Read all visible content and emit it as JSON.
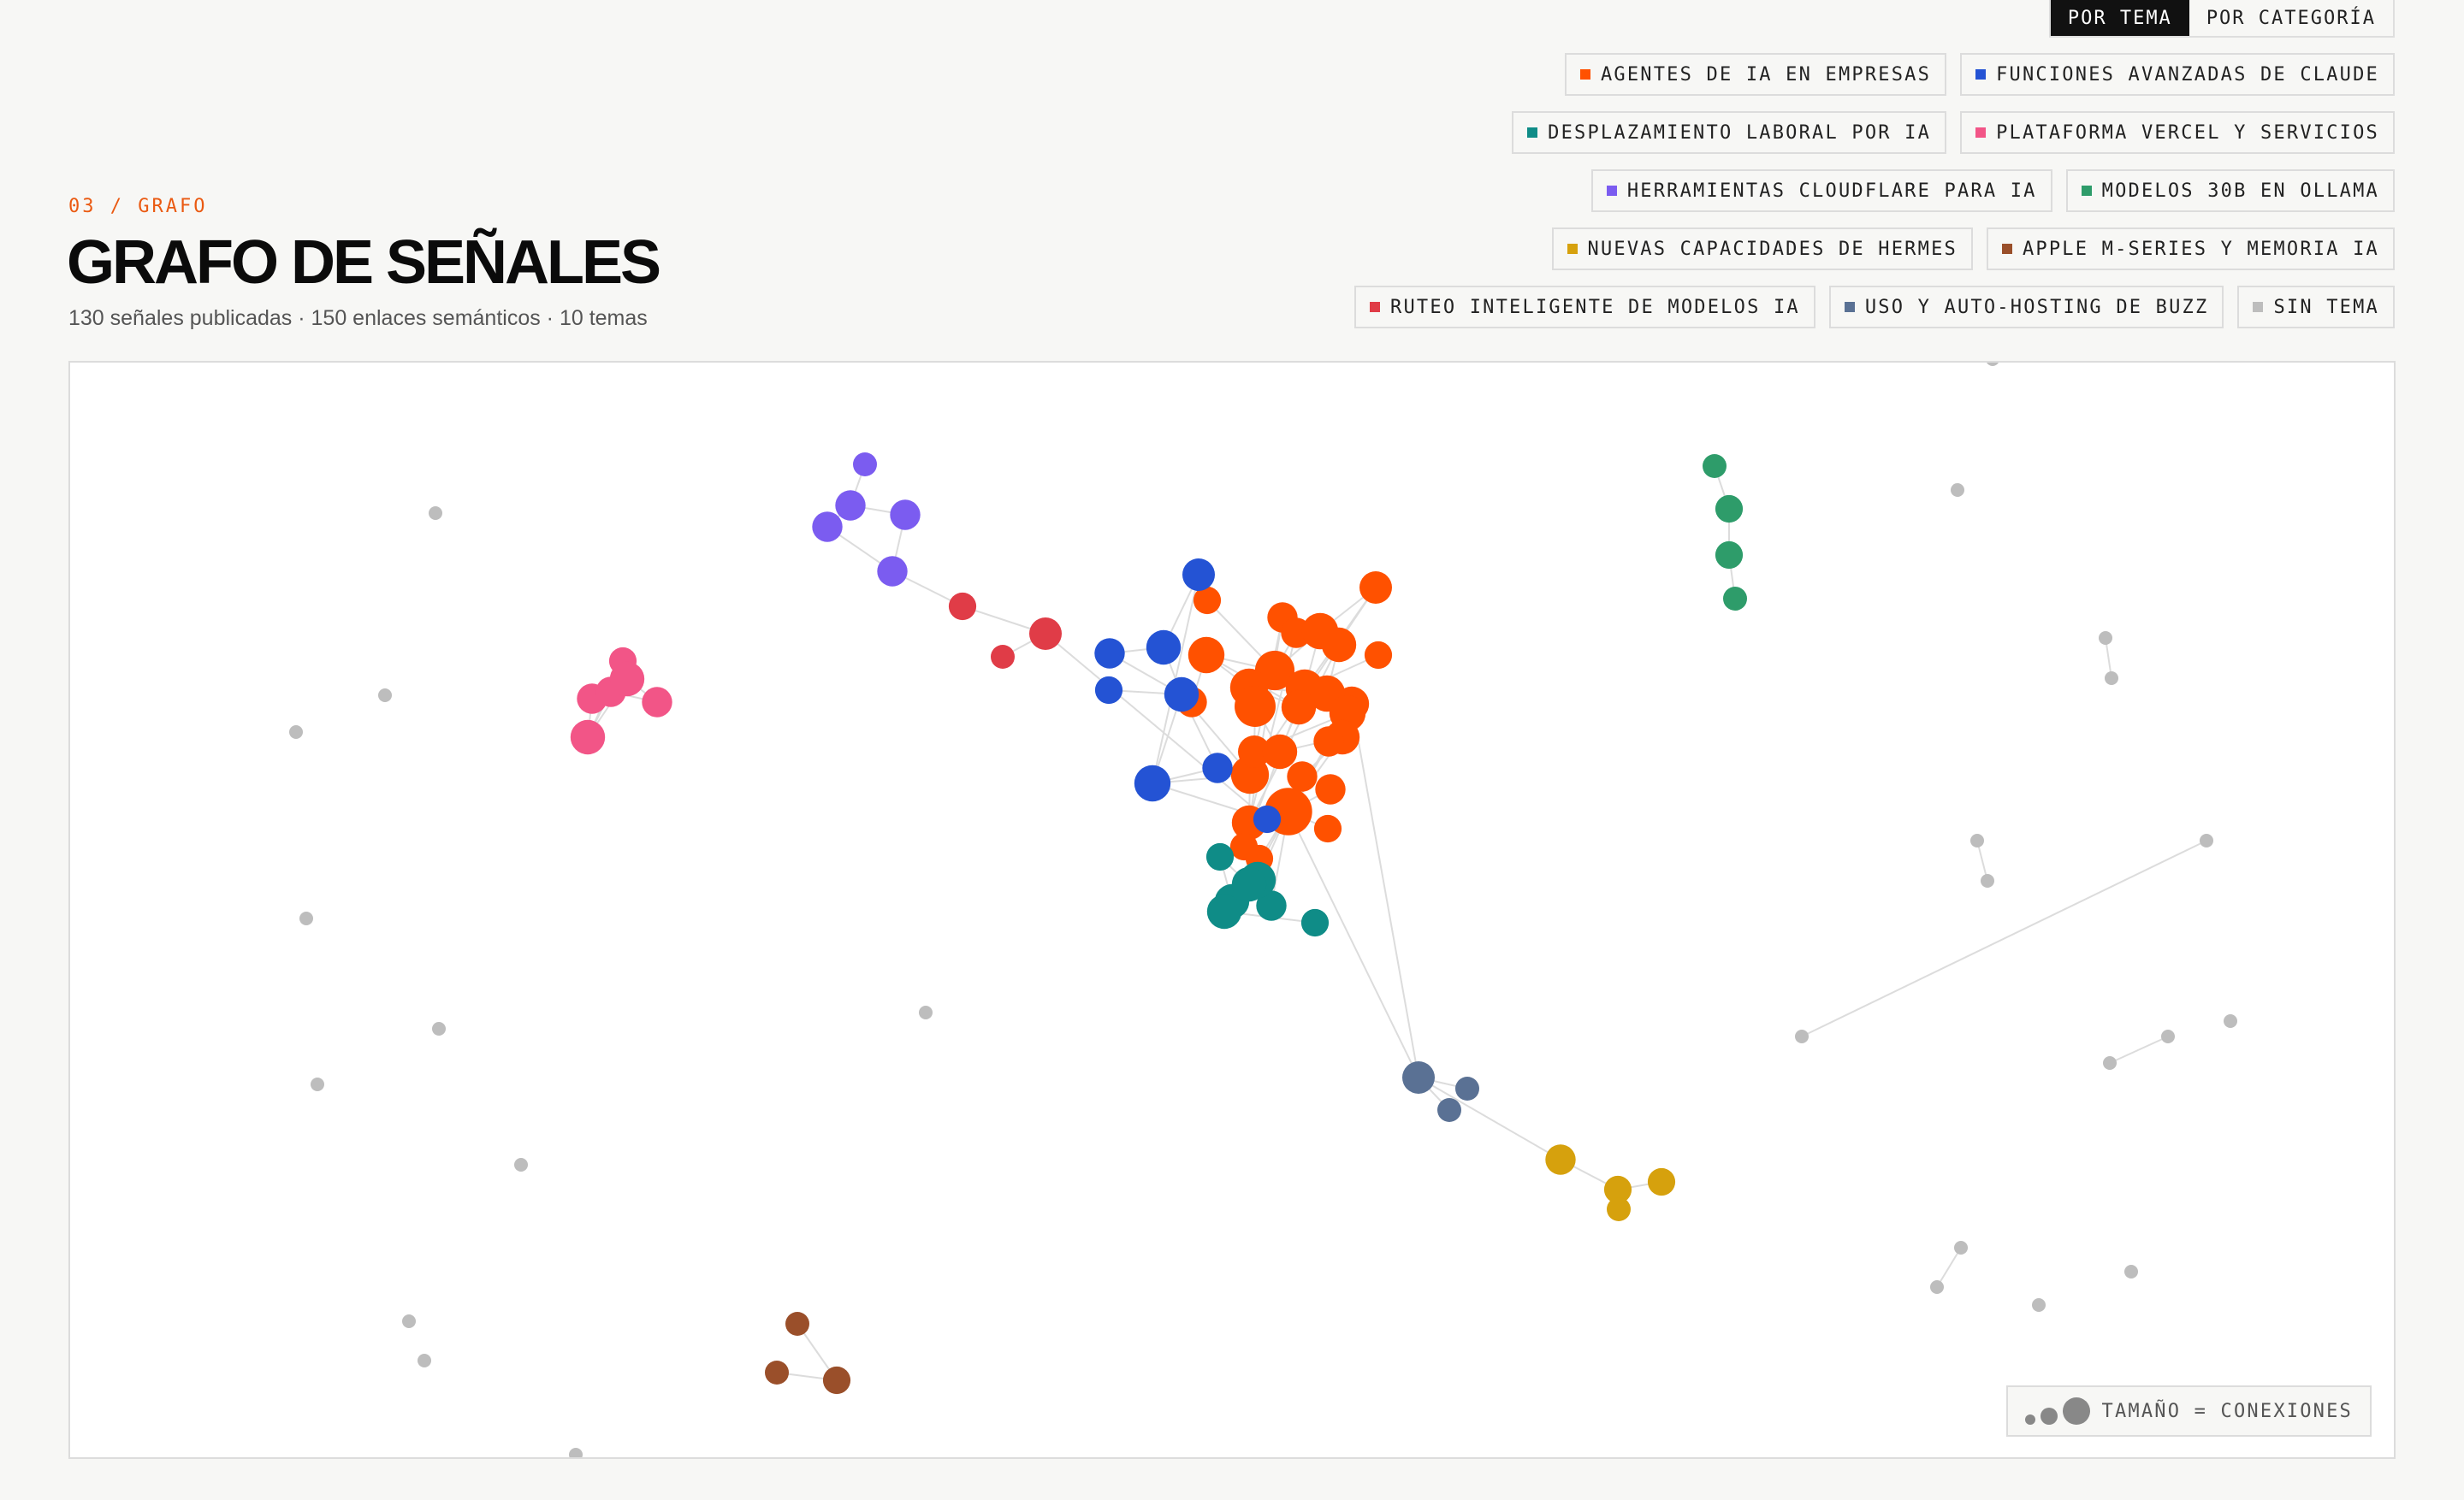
{
  "view_toggle": [
    {
      "label": "POR TEMA",
      "active": true
    },
    {
      "label": "POR CATEGORÍA",
      "active": false
    }
  ],
  "themes": [
    {
      "id": "agentes",
      "label": "AGENTES DE IA EN EMPRESAS",
      "color": "#ff5100"
    },
    {
      "id": "claude",
      "label": "FUNCIONES AVANZADAS DE CLAUDE",
      "color": "#2453d4"
    },
    {
      "id": "laboral",
      "label": "DESPLAZAMIENTO LABORAL POR IA",
      "color": "#0f8c87"
    },
    {
      "id": "vercel",
      "label": "PLATAFORMA VERCEL Y SERVICIOS",
      "color": "#f25587"
    },
    {
      "id": "cloudflare",
      "label": "HERRAMIENTAS CLOUDFLARE PARA IA",
      "color": "#7b5cf0"
    },
    {
      "id": "ollama",
      "label": "MODELOS 30B EN OLLAMA",
      "color": "#2e9c6a"
    },
    {
      "id": "hermes",
      "label": "NUEVAS CAPACIDADES DE HERMES",
      "color": "#d6a10d"
    },
    {
      "id": "apple",
      "label": "APPLE M-SERIES Y MEMORIA IA",
      "color": "#9a4f2a"
    },
    {
      "id": "ruteo",
      "label": "RUTEO INTELIGENTE DE MODELOS IA",
      "color": "#e03c47"
    },
    {
      "id": "buzz",
      "label": "USO Y AUTO-HOSTING DE BUZZ",
      "color": "#5a7194"
    },
    {
      "id": "none",
      "label": "SIN TEMA",
      "color": "#bdbdbd"
    }
  ],
  "header": {
    "kicker": "03 / GRAFO",
    "title": "GRAFO DE SEÑALES",
    "subtitle": "130 señales publicadas · 150 enlaces semánticos · 10 temas"
  },
  "size_legend": {
    "label": "TAMAÑO = CONEXIONES"
  },
  "graph": {
    "nodes": [
      {
        "id": "a1",
        "theme": "agentes",
        "deg": 7
      },
      {
        "id": "a2",
        "theme": "agentes",
        "deg": 2
      },
      {
        "id": "a3",
        "theme": "agentes",
        "deg": 3
      },
      {
        "id": "a4",
        "theme": "agentes",
        "deg": 5
      },
      {
        "id": "a5",
        "theme": "agentes",
        "deg": 4
      },
      {
        "id": "a6",
        "theme": "agentes",
        "deg": 3
      },
      {
        "id": "a7",
        "theme": "agentes",
        "deg": 6
      },
      {
        "id": "a8",
        "theme": "agentes",
        "deg": 5
      },
      {
        "id": "a9",
        "theme": "agentes",
        "deg": 8
      },
      {
        "id": "a10",
        "theme": "agentes",
        "deg": 7
      },
      {
        "id": "a11",
        "theme": "agentes",
        "deg": 6
      },
      {
        "id": "a12",
        "theme": "agentes",
        "deg": 2
      },
      {
        "id": "a13",
        "theme": "agentes",
        "deg": 6
      },
      {
        "id": "a14",
        "theme": "agentes",
        "deg": 3
      },
      {
        "id": "a15",
        "theme": "agentes",
        "deg": 7
      },
      {
        "id": "a16",
        "theme": "agentes",
        "deg": 9
      },
      {
        "id": "a17",
        "theme": "agentes",
        "deg": 5
      },
      {
        "id": "a18",
        "theme": "agentes",
        "deg": 5
      },
      {
        "id": "a19",
        "theme": "agentes",
        "deg": 4
      },
      {
        "id": "a20",
        "theme": "agentes",
        "deg": 5
      },
      {
        "id": "a21",
        "theme": "agentes",
        "deg": 6
      },
      {
        "id": "a22",
        "theme": "agentes",
        "deg": 5
      },
      {
        "id": "a23",
        "theme": "agentes",
        "deg": 3
      },
      {
        "id": "a24",
        "theme": "agentes",
        "deg": 14
      },
      {
        "id": "a25",
        "theme": "agentes",
        "deg": 3
      },
      {
        "id": "a26",
        "theme": "agentes",
        "deg": 3
      },
      {
        "id": "a27",
        "theme": "agentes",
        "deg": 2
      },
      {
        "id": "a28",
        "theme": "agentes",
        "deg": 2
      },
      {
        "id": "a29",
        "theme": "agentes",
        "deg": 2
      },
      {
        "id": "c1",
        "theme": "claude",
        "deg": 2
      },
      {
        "id": "c2",
        "theme": "claude",
        "deg": 5
      },
      {
        "id": "c3",
        "theme": "claude",
        "deg": 3
      },
      {
        "id": "c4",
        "theme": "claude",
        "deg": 4
      },
      {
        "id": "c5",
        "theme": "claude",
        "deg": 5
      },
      {
        "id": "c6",
        "theme": "claude",
        "deg": 6
      },
      {
        "id": "c7",
        "theme": "claude",
        "deg": 3
      },
      {
        "id": "c8",
        "theme": "claude",
        "deg": 2
      },
      {
        "id": "l1",
        "theme": "laboral",
        "deg": 3
      },
      {
        "id": "l2",
        "theme": "laboral",
        "deg": 2
      },
      {
        "id": "l3",
        "theme": "laboral",
        "deg": 6
      },
      {
        "id": "l4",
        "theme": "laboral",
        "deg": 5
      },
      {
        "id": "l5",
        "theme": "laboral",
        "deg": 5
      },
      {
        "id": "l6",
        "theme": "laboral",
        "deg": 5
      },
      {
        "id": "l7",
        "theme": "laboral",
        "deg": 2
      },
      {
        "id": "v1",
        "theme": "vercel",
        "deg": 3
      },
      {
        "id": "v2",
        "theme": "vercel",
        "deg": 5
      },
      {
        "id": "v3",
        "theme": "vercel",
        "deg": 3
      },
      {
        "id": "v4",
        "theme": "vercel",
        "deg": 2
      },
      {
        "id": "v5",
        "theme": "vercel",
        "deg": 5
      },
      {
        "id": "v6",
        "theme": "vercel",
        "deg": 3
      },
      {
        "id": "f1",
        "theme": "cloudflare",
        "deg": 1
      },
      {
        "id": "f2",
        "theme": "cloudflare",
        "deg": 3
      },
      {
        "id": "f3",
        "theme": "cloudflare",
        "deg": 3
      },
      {
        "id": "f4",
        "theme": "cloudflare",
        "deg": 3
      },
      {
        "id": "f5",
        "theme": "cloudflare",
        "deg": 3
      },
      {
        "id": "o1",
        "theme": "ollama",
        "deg": 1
      },
      {
        "id": "o2",
        "theme": "ollama",
        "deg": 2
      },
      {
        "id": "o3",
        "theme": "ollama",
        "deg": 2
      },
      {
        "id": "o4",
        "theme": "ollama",
        "deg": 1
      },
      {
        "id": "h1",
        "theme": "hermes",
        "deg": 3
      },
      {
        "id": "h2",
        "theme": "hermes",
        "deg": 2
      },
      {
        "id": "h3",
        "theme": "hermes",
        "deg": 2
      },
      {
        "id": "h4",
        "theme": "hermes",
        "deg": 1
      },
      {
        "id": "p1",
        "theme": "apple",
        "deg": 1
      },
      {
        "id": "p2",
        "theme": "apple",
        "deg": 1
      },
      {
        "id": "p3",
        "theme": "apple",
        "deg": 2
      },
      {
        "id": "r1",
        "theme": "ruteo",
        "deg": 2
      },
      {
        "id": "r2",
        "theme": "ruteo",
        "deg": 4
      },
      {
        "id": "r3",
        "theme": "ruteo",
        "deg": 1
      },
      {
        "id": "b1",
        "theme": "buzz",
        "deg": 4
      },
      {
        "id": "b2",
        "theme": "buzz",
        "deg": 1
      },
      {
        "id": "b3",
        "theme": "buzz",
        "deg": 1
      },
      {
        "id": "n1",
        "theme": "none",
        "deg": 1
      },
      {
        "id": "n2",
        "theme": "none",
        "deg": 1
      },
      {
        "id": "n3",
        "theme": "none",
        "deg": 1
      },
      {
        "id": "n4",
        "theme": "none",
        "deg": 1
      },
      {
        "id": "n5",
        "theme": "none",
        "deg": 1
      },
      {
        "id": "n6",
        "theme": "none",
        "deg": 1
      },
      {
        "id": "n7",
        "theme": "none",
        "deg": 1
      },
      {
        "id": "n8",
        "theme": "none",
        "deg": 1
      },
      {
        "id": "n9",
        "theme": "none",
        "deg": 1
      },
      {
        "id": "n10",
        "theme": "none",
        "deg": 1
      },
      {
        "id": "n11",
        "theme": "none",
        "deg": 1
      },
      {
        "id": "n12",
        "theme": "none",
        "deg": 1
      },
      {
        "id": "n13",
        "theme": "none",
        "deg": 1
      },
      {
        "id": "n14",
        "theme": "none",
        "deg": 1
      },
      {
        "id": "n15",
        "theme": "none",
        "deg": 1
      },
      {
        "id": "n16",
        "theme": "none",
        "deg": 1
      },
      {
        "id": "n17",
        "theme": "none",
        "deg": 1
      },
      {
        "id": "n18",
        "theme": "none",
        "deg": 1
      },
      {
        "id": "n19",
        "theme": "none",
        "deg": 1
      },
      {
        "id": "n20",
        "theme": "none",
        "deg": 1
      },
      {
        "id": "n21",
        "theme": "none",
        "deg": 1
      },
      {
        "id": "n22",
        "theme": "none",
        "deg": 1
      },
      {
        "id": "n23",
        "theme": "none",
        "deg": 1
      },
      {
        "id": "n24",
        "theme": "none",
        "deg": 1
      },
      {
        "id": "n25",
        "theme": "none",
        "deg": 1
      },
      {
        "id": "n26",
        "theme": "none",
        "deg": 1
      }
    ],
    "edges": [
      [
        "a1",
        "a3"
      ],
      [
        "a1",
        "a4"
      ],
      [
        "a1",
        "a5"
      ],
      [
        "a1",
        "c5"
      ],
      [
        "a1",
        "c6"
      ],
      [
        "a3",
        "a4"
      ],
      [
        "a4",
        "a6"
      ],
      [
        "a4",
        "a8"
      ],
      [
        "a5",
        "a7"
      ],
      [
        "a6",
        "a7"
      ],
      [
        "a6",
        "a9"
      ],
      [
        "a7",
        "a8"
      ],
      [
        "a7",
        "a9"
      ],
      [
        "a7",
        "a10"
      ],
      [
        "a8",
        "a11"
      ],
      [
        "a9",
        "a13"
      ],
      [
        "a9",
        "a15"
      ],
      [
        "a10",
        "a11"
      ],
      [
        "a10",
        "a12"
      ],
      [
        "a11",
        "a15"
      ],
      [
        "a11",
        "a18"
      ],
      [
        "a13",
        "a14"
      ],
      [
        "a13",
        "a15"
      ],
      [
        "a13",
        "a17"
      ],
      [
        "a15",
        "a16"
      ],
      [
        "a15",
        "a17"
      ],
      [
        "a16",
        "a19"
      ],
      [
        "a16",
        "a20"
      ],
      [
        "a17",
        "a20"
      ],
      [
        "a18",
        "a21"
      ],
      [
        "a19",
        "a21"
      ],
      [
        "a20",
        "a22"
      ],
      [
        "a21",
        "a22"
      ],
      [
        "a21",
        "a24"
      ],
      [
        "a22",
        "a24"
      ],
      [
        "a22",
        "a23"
      ],
      [
        "a23",
        "a24"
      ],
      [
        "a24",
        "a25"
      ],
      [
        "a24",
        "a26"
      ],
      [
        "a24",
        "a28"
      ],
      [
        "a24",
        "l1"
      ],
      [
        "a24",
        "l3"
      ],
      [
        "a24",
        "l5"
      ],
      [
        "a18",
        "b1"
      ],
      [
        "a24",
        "b1"
      ],
      [
        "a2",
        "a9"
      ],
      [
        "a27",
        "a10"
      ],
      [
        "a29",
        "a24"
      ],
      [
        "a5",
        "a10"
      ],
      [
        "c1",
        "c5"
      ],
      [
        "c2",
        "c3"
      ],
      [
        "c2",
        "c4"
      ],
      [
        "c2",
        "c5"
      ],
      [
        "c3",
        "c5"
      ],
      [
        "c4",
        "c6"
      ],
      [
        "c5",
        "c6"
      ],
      [
        "c6",
        "c7"
      ],
      [
        "c5",
        "c7"
      ],
      [
        "c8",
        "c6"
      ],
      [
        "r2",
        "c8"
      ],
      [
        "r1",
        "r2"
      ],
      [
        "r3",
        "r2"
      ],
      [
        "f5",
        "r1"
      ],
      [
        "f1",
        "f2"
      ],
      [
        "f2",
        "f3"
      ],
      [
        "f2",
        "f4"
      ],
      [
        "f3",
        "f5"
      ],
      [
        "f4",
        "f5"
      ],
      [
        "v1",
        "v2"
      ],
      [
        "v1",
        "v3"
      ],
      [
        "v2",
        "v3"
      ],
      [
        "v2",
        "v5"
      ],
      [
        "v3",
        "v6"
      ],
      [
        "v5",
        "v6"
      ],
      [
        "v4",
        "v2"
      ],
      [
        "v5",
        "v1"
      ],
      [
        "o1",
        "o2"
      ],
      [
        "o2",
        "o3"
      ],
      [
        "o3",
        "o4"
      ],
      [
        "l1",
        "l2"
      ],
      [
        "l1",
        "l3"
      ],
      [
        "l2",
        "l4"
      ],
      [
        "l3",
        "l4"
      ],
      [
        "l3",
        "l6"
      ],
      [
        "l4",
        "l5"
      ],
      [
        "l5",
        "l6"
      ],
      [
        "l6",
        "l7"
      ],
      [
        "l5",
        "l3"
      ],
      [
        "b1",
        "b2"
      ],
      [
        "b1",
        "b3"
      ],
      [
        "b1",
        "h1"
      ],
      [
        "h1",
        "h2"
      ],
      [
        "h2",
        "h3"
      ],
      [
        "h2",
        "h4"
      ],
      [
        "p1",
        "p3"
      ],
      [
        "p2",
        "p3"
      ],
      [
        "n5",
        "n6"
      ],
      [
        "n7",
        "n8"
      ],
      [
        "n9",
        "n10"
      ],
      [
        "n11",
        "n12"
      ],
      [
        "n13",
        "n14"
      ]
    ]
  }
}
